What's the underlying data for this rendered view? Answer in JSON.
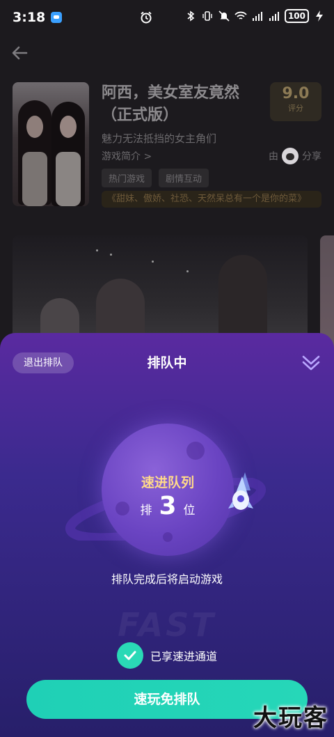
{
  "status_bar": {
    "time": "3:18",
    "battery": "100",
    "icons": [
      "message-badge-icon",
      "alarm-icon",
      "bluetooth-icon",
      "vibrate-icon",
      "mute-icon",
      "wifi-icon",
      "signal-4g-icon",
      "signal-4g-icon",
      "battery-icon",
      "charging-icon"
    ]
  },
  "game": {
    "title": "阿西，美女室友竟然（正式版）",
    "score": "9.0",
    "score_label": "评分",
    "subtitle": "魅力无法抵挡的女主角们",
    "intro_link": "游戏简介 >",
    "share_prefix": "由",
    "share_label": "分享",
    "tags": [
      "热门游戏",
      "剧情互动"
    ],
    "slogan": "《甜妹、傲娇、社恐、天然呆总有一个是你的菜》"
  },
  "queue": {
    "exit_label": "退出排队",
    "title": "排队中",
    "queue_name": "速进队列",
    "position_prefix": "排",
    "position": "3",
    "position_suffix": "位",
    "hint": "排队完成后将启动游戏",
    "watermark": "FAST",
    "fast_lane_label": "已享速进通道",
    "cta_label": "速玩免排队"
  },
  "watermark_logo": "大玩客",
  "colors": {
    "sheet_top": "#5a2aa0",
    "sheet_bottom": "#271f6a",
    "accent_teal": "#26d7b8",
    "queue_gold": "#ffd98a"
  }
}
